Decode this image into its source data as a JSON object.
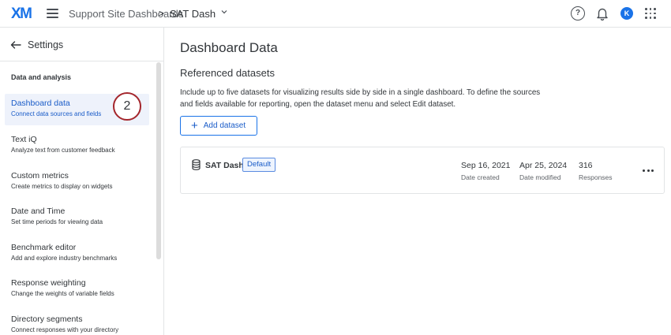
{
  "topbar": {
    "logo": "XM",
    "breadcrumb_parent": "Support Site Dashboards",
    "breadcrumb_separator": ">",
    "breadcrumb_current": "SAT Dash",
    "help_glyph": "?",
    "avatar_initial": "K"
  },
  "sidebar": {
    "back_label": "Settings",
    "section_label": "Data and analysis",
    "step_badge": "2",
    "items": [
      {
        "title": "Dashboard data",
        "subtitle": "Connect data sources and fields"
      },
      {
        "title": "Text iQ",
        "subtitle": "Analyze text from customer feedback"
      },
      {
        "title": "Custom metrics",
        "subtitle": "Create metrics to display on widgets"
      },
      {
        "title": "Date and Time",
        "subtitle": "Set time periods for viewing data"
      },
      {
        "title": "Benchmark editor",
        "subtitle": "Add and explore industry benchmarks"
      },
      {
        "title": "Response weighting",
        "subtitle": "Change the weights of variable fields"
      },
      {
        "title": "Directory segments",
        "subtitle": "Connect responses with your directory"
      }
    ]
  },
  "main": {
    "title": "Dashboard Data",
    "section_title": "Referenced datasets",
    "description": "Include up to five datasets for visualizing results side by side in a single dashboard. To define the sources and fields available for reporting, open the dataset menu and select Edit dataset.",
    "add_button_label": "Add dataset",
    "dataset": {
      "name": "SAT Dash",
      "badge": "Default",
      "date_created": "Sep 16, 2021",
      "date_created_label": "Date created",
      "date_modified": "Apr 25, 2024",
      "date_modified_label": "Date modified",
      "responses": "316",
      "responses_label": "Responses"
    }
  },
  "colors": {
    "accent": "#1a73e8",
    "active_bg": "#eef2fb",
    "step_ring": "#a4262c"
  }
}
